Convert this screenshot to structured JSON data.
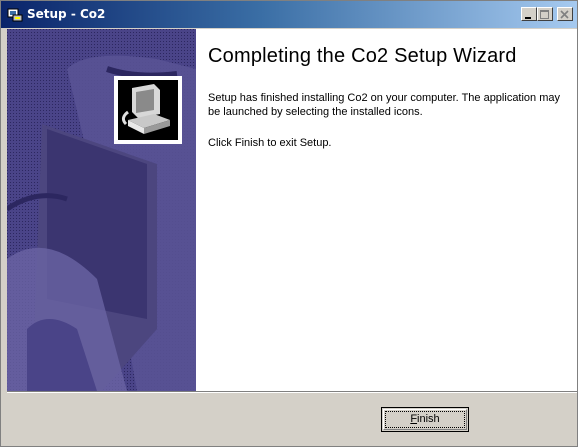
{
  "window": {
    "title": "Setup - Co2"
  },
  "content": {
    "heading": "Completing the Co2 Setup Wizard",
    "body_text": "Setup has finished installing Co2 on your computer. The application may be launched by selecting the installed icons.",
    "exit_text": "Click Finish to exit Setup."
  },
  "buttons": {
    "finish_mnemonic": "F",
    "finish_rest": "inish"
  },
  "colors": {
    "title_start": "#0a246a",
    "title_end": "#a6caf0",
    "sidebar": "#3c3675",
    "face": "#d4d0c8"
  },
  "icons": [
    "setup-icon",
    "minimize-icon",
    "maximize-icon",
    "close-icon",
    "computer-logo-icon"
  ]
}
